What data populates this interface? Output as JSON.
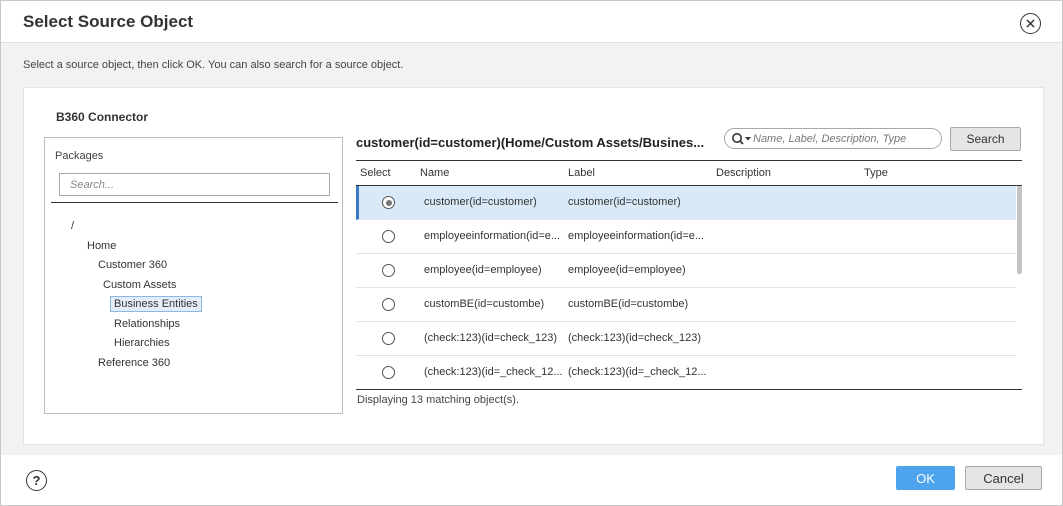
{
  "dialog": {
    "title": "Select Source Object",
    "instruction": "Select a source object, then click OK. You can also search for a source object."
  },
  "connector": {
    "title": "B360 Connector"
  },
  "packages": {
    "label": "Packages",
    "search_placeholder": "Search...",
    "tree": [
      {
        "label": "/"
      },
      {
        "label": "Home"
      },
      {
        "label": "Customer 360"
      },
      {
        "label": "Custom Assets"
      },
      {
        "label": "Business Entities",
        "selected": true
      },
      {
        "label": "Relationships"
      },
      {
        "label": "Hierarchies"
      },
      {
        "label": "Reference 360"
      }
    ]
  },
  "objects": {
    "heading": "customer(id=customer)(Home/Custom Assets/Busines...",
    "search_placeholder": "Name, Label, Description, Type",
    "search_button": "Search",
    "columns": [
      "Select",
      "Name",
      "Label",
      "Description",
      "Type"
    ],
    "rows": [
      {
        "name": "customer(id=customer)",
        "label": "customer(id=customer)",
        "selected": true
      },
      {
        "name": "employeeinformation(id=e...",
        "label": "employeeinformation(id=e...",
        "selected": false
      },
      {
        "name": "employee(id=employee)",
        "label": "employee(id=employee)",
        "selected": false
      },
      {
        "name": "customBE(id=custombe)",
        "label": "customBE(id=custombe)",
        "selected": false
      },
      {
        "name": "(check:123)(id=check_123)",
        "label": "(check:123)(id=check_123)",
        "selected": false
      },
      {
        "name": "(check:123)(id=_check_12...",
        "label": "(check:123)(id=_check_12...",
        "selected": false
      }
    ],
    "count_text": "Displaying 13 matching object(s)."
  },
  "footer": {
    "help": "?",
    "ok": "OK",
    "cancel": "Cancel"
  },
  "colors": {
    "accent": "#4da3ec",
    "selection": "#d9e9f8"
  }
}
